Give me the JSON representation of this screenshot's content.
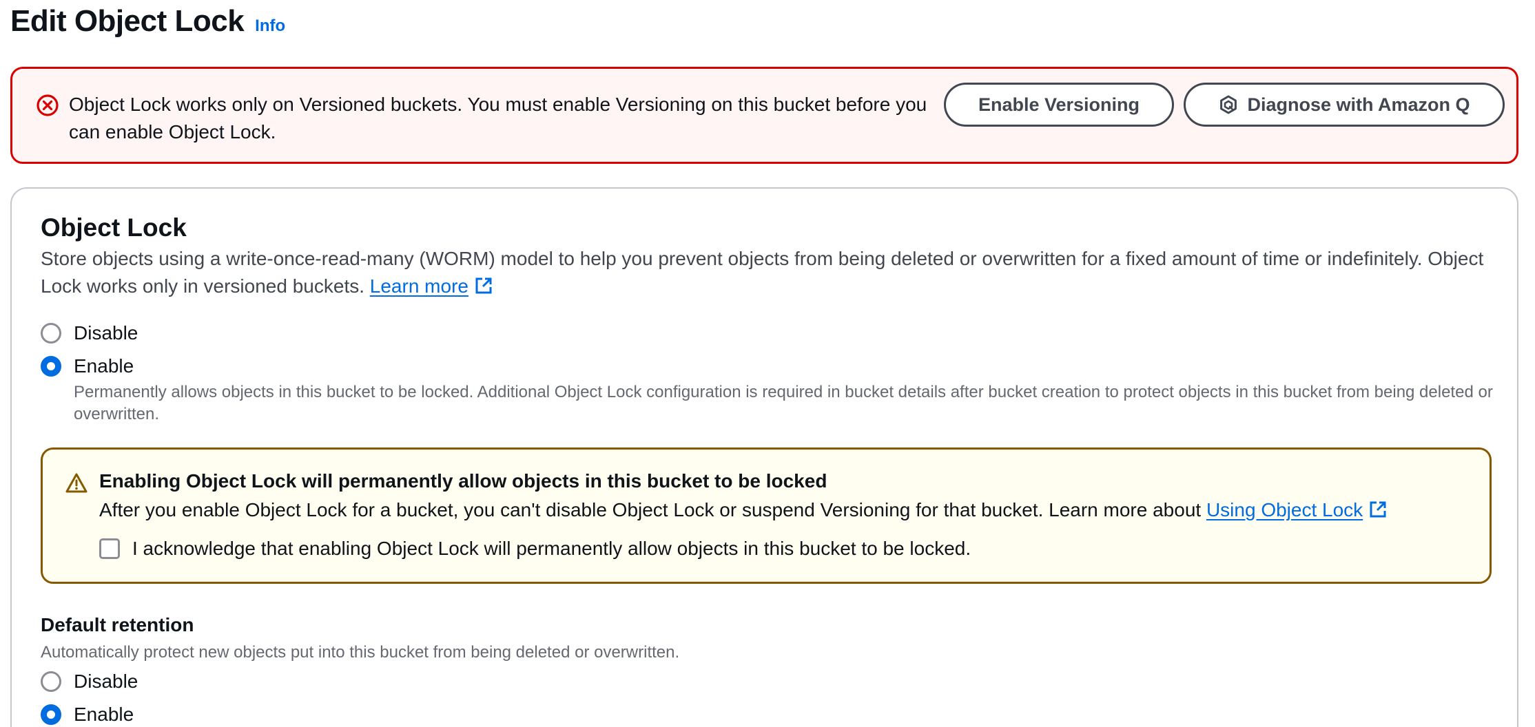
{
  "header": {
    "title": "Edit Object Lock",
    "info_label": "Info"
  },
  "error_alert": {
    "message": "Object Lock works only on Versioned buckets. You must enable Versioning on this bucket before you can enable Object Lock.",
    "icon": "error-circle-x-icon",
    "enable_versioning_label": "Enable Versioning",
    "diagnose_label": "Diagnose with Amazon Q",
    "diagnose_icon": "amazon-q-icon"
  },
  "object_lock": {
    "title": "Object Lock",
    "description": "Store objects using a write-once-read-many (WORM) model to help you prevent objects from being deleted or overwritten for a fixed amount of time or indefinitely. Object Lock works only in versioned buckets.",
    "learn_more_label": "Learn more",
    "options": [
      {
        "label": "Disable",
        "checked": false
      },
      {
        "label": "Enable",
        "checked": true
      }
    ],
    "enable_description": "Permanently allows objects in this bucket to be locked. Additional Object Lock configuration is required in bucket details after bucket creation to protect objects in this bucket from being deleted or overwritten."
  },
  "warning": {
    "icon": "warning-triangle-icon",
    "title": "Enabling Object Lock will permanently allow objects in this bucket to be locked",
    "body": "After you enable Object Lock for a bucket, you can't disable Object Lock or suspend Versioning for that bucket. Learn more about",
    "link_label": "Using Object Lock",
    "acknowledge_label": "I acknowledge that enabling Object Lock will permanently allow objects in this bucket to be locked.",
    "acknowledged": false
  },
  "default_retention": {
    "title": "Default retention",
    "description": "Automatically protect new objects put into this bucket from being deleted or overwritten.",
    "options": [
      {
        "label": "Disable",
        "checked": false
      },
      {
        "label": "Enable",
        "checked": true
      }
    ]
  },
  "colors": {
    "link": "#006ce0",
    "error_border": "#db0000",
    "error_bg": "#fff5f5",
    "warning_border": "#855900",
    "warning_bg": "#fffef0",
    "radio_checked": "#006ce0"
  }
}
